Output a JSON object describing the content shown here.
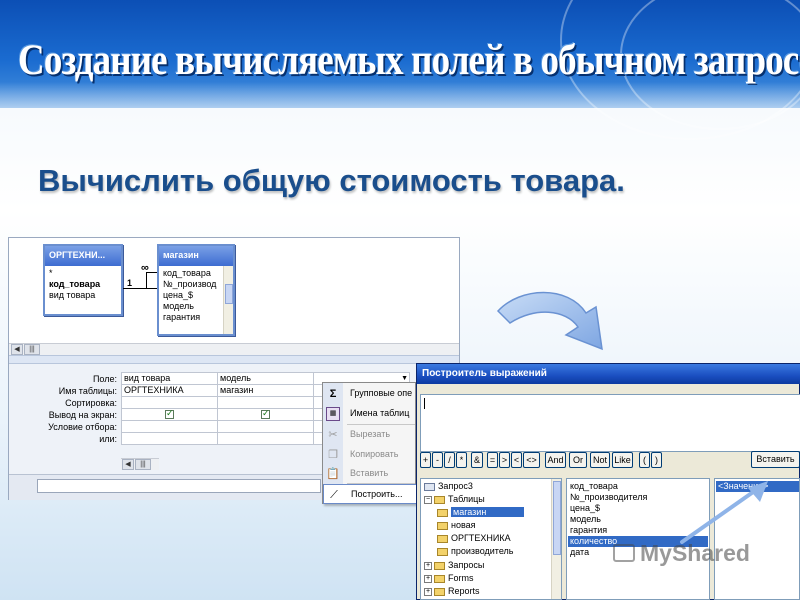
{
  "slide": {
    "title": "Создание вычисляемых полей в обычном запросе",
    "subtitle": "Вычислить общую стоимость товара",
    "subtitle_dot": "."
  },
  "query_design": {
    "table1": {
      "title": "ОРГТЕХНИ...",
      "fields": [
        "*",
        "код_товара",
        "вид товара"
      ]
    },
    "table2": {
      "title": "магазин",
      "fields": [
        "код_товара",
        "№_производ",
        "цена_$",
        "модель",
        "гарантия"
      ]
    },
    "relation": {
      "one": "1",
      "many": "∞"
    },
    "row_labels": [
      "Поле:",
      "Имя таблицы:",
      "Сортировка:",
      "Вывод на экран:",
      "Условие отбора:",
      "или:"
    ],
    "columns": [
      {
        "field": "вид товара",
        "table": "ОРГТЕХНИКА",
        "show": true
      },
      {
        "field": "модель",
        "table": "магазин",
        "show": true
      },
      {
        "field": "",
        "table": "",
        "show": false
      }
    ]
  },
  "context_menu": {
    "items": [
      {
        "label": "Групповые опе",
        "icon": "sigma-icon",
        "disabled": false
      },
      {
        "label": "Имена таблиц",
        "icon": "table-names-icon",
        "disabled": false
      },
      {
        "label": "Вырезать",
        "icon": "scissors-icon",
        "disabled": true
      },
      {
        "label": "Копировать",
        "icon": "copy-icon",
        "disabled": true
      },
      {
        "label": "Вставить",
        "icon": "paste-icon",
        "disabled": true
      },
      {
        "label": "Построить...",
        "icon": "build-wand-icon",
        "disabled": false
      }
    ]
  },
  "expression_builder": {
    "title": "Построитель выражений",
    "expression": "",
    "operators": [
      "+",
      "-",
      "/",
      "*",
      "&",
      "=",
      ">",
      "<",
      "<>",
      "And",
      "Or",
      "Not",
      "Like",
      "(",
      ")"
    ],
    "insert_label": "Вставить",
    "tree": [
      {
        "label": "Запрос3",
        "kind": "query",
        "level": 0
      },
      {
        "label": "Таблицы",
        "kind": "folder-open",
        "level": 0
      },
      {
        "label": "магазин",
        "kind": "folder",
        "level": 1,
        "selected": true
      },
      {
        "label": "новая",
        "kind": "folder",
        "level": 1
      },
      {
        "label": "ОРГТЕХНИКА",
        "kind": "folder",
        "level": 1
      },
      {
        "label": "производитель",
        "kind": "folder",
        "level": 1
      },
      {
        "label": "Запросы",
        "kind": "plus",
        "level": 0
      },
      {
        "label": "Forms",
        "kind": "plus",
        "level": 0
      },
      {
        "label": "Reports",
        "kind": "plus",
        "level": 0
      }
    ],
    "fields": [
      "код_товара",
      "№_производителя",
      "цена_$",
      "модель",
      "гарантия",
      "количество",
      "дата"
    ],
    "selected_field": "количество",
    "values": [
      "<Значение>"
    ]
  },
  "watermark": "MyShared",
  "colors": {
    "banner": "#1a6bd0",
    "subtitle": "#1a4e8c",
    "selection": "#316ac5",
    "arrow": "#8fb4e8"
  }
}
